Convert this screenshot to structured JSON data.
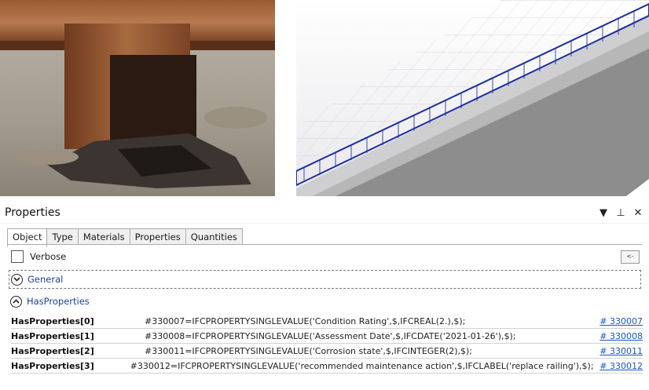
{
  "panel": {
    "title": "Properties",
    "controls": {
      "dropdown": "▾",
      "pin": "ᵖ",
      "close": "✕"
    }
  },
  "tabs": [
    {
      "label": "Object",
      "active": true
    },
    {
      "label": "Type",
      "active": false
    },
    {
      "label": "Materials",
      "active": false
    },
    {
      "label": "Properties",
      "active": false
    },
    {
      "label": "Quantities",
      "active": false
    }
  ],
  "verbose": {
    "label": "Verbose",
    "checked": false
  },
  "back_button": {
    "label": "<-"
  },
  "groups": {
    "general": {
      "label": "General",
      "expanded": false
    },
    "has_properties": {
      "label": "HasProperties",
      "expanded": true
    }
  },
  "rows": [
    {
      "name": "HasProperties[0]",
      "value": "#330007=IFCPROPERTYSINGLEVALUE('Condition Rating',$,IFCREAL(2.),$);",
      "ref": "# 330007"
    },
    {
      "name": "HasProperties[1]",
      "value": "#330008=IFCPROPERTYSINGLEVALUE('Assessment Date',$,IFCDATE('2021-01-26'),$);",
      "ref": "# 330008"
    },
    {
      "name": "HasProperties[2]",
      "value": "#330011=IFCPROPERTYSINGLEVALUE('Corrosion state',$,IFCINTEGER(2),$);",
      "ref": "# 330011"
    },
    {
      "name": "HasProperties[3]",
      "value": "#330012=IFCPROPERTYSINGLEVALUE('recommended maintenance action',$,IFCLABEL('replace railing'),$);",
      "ref": "# 330012"
    }
  ],
  "colors": {
    "link": "#1a55c8",
    "group_label": "#1f3f9a",
    "railing": "#1c2fa0",
    "rust": "#8a4a26"
  }
}
